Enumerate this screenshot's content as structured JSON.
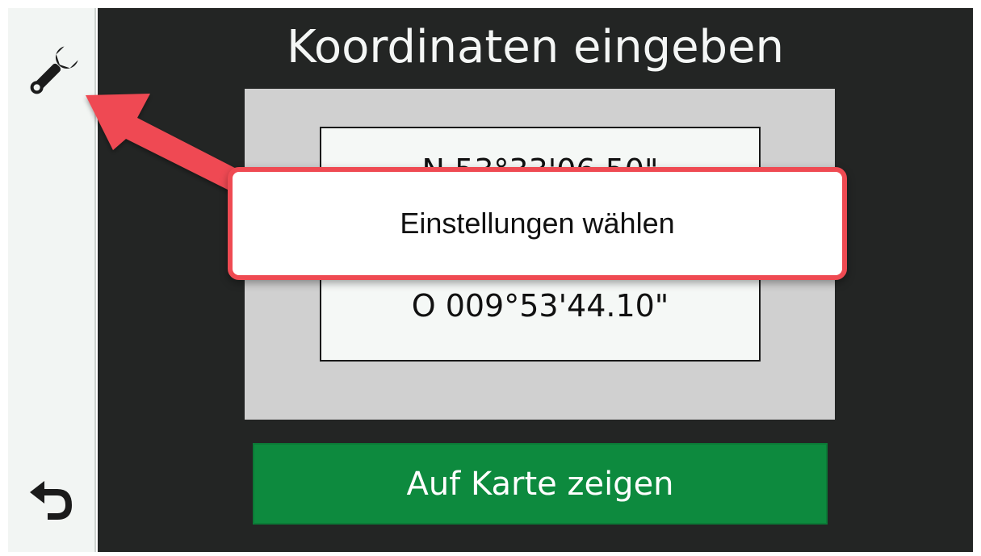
{
  "screen": {
    "title": "Koordinaten eingeben"
  },
  "sidebar": {
    "settings_icon": "wrench-icon",
    "back_icon": "back-arrow-icon"
  },
  "coordinates": {
    "latitude": "N 53°33'06.50\"",
    "longitude": "O 009°53'44.10\""
  },
  "actions": {
    "show_on_map_label": "Auf Karte zeigen"
  },
  "annotation": {
    "callout_text": "Einstellungen wählen",
    "color": "#ef4a52"
  },
  "colors": {
    "screen_background": "#232524",
    "button_green": "#0d8a3e",
    "panel_gray": "#d0d0d0"
  }
}
